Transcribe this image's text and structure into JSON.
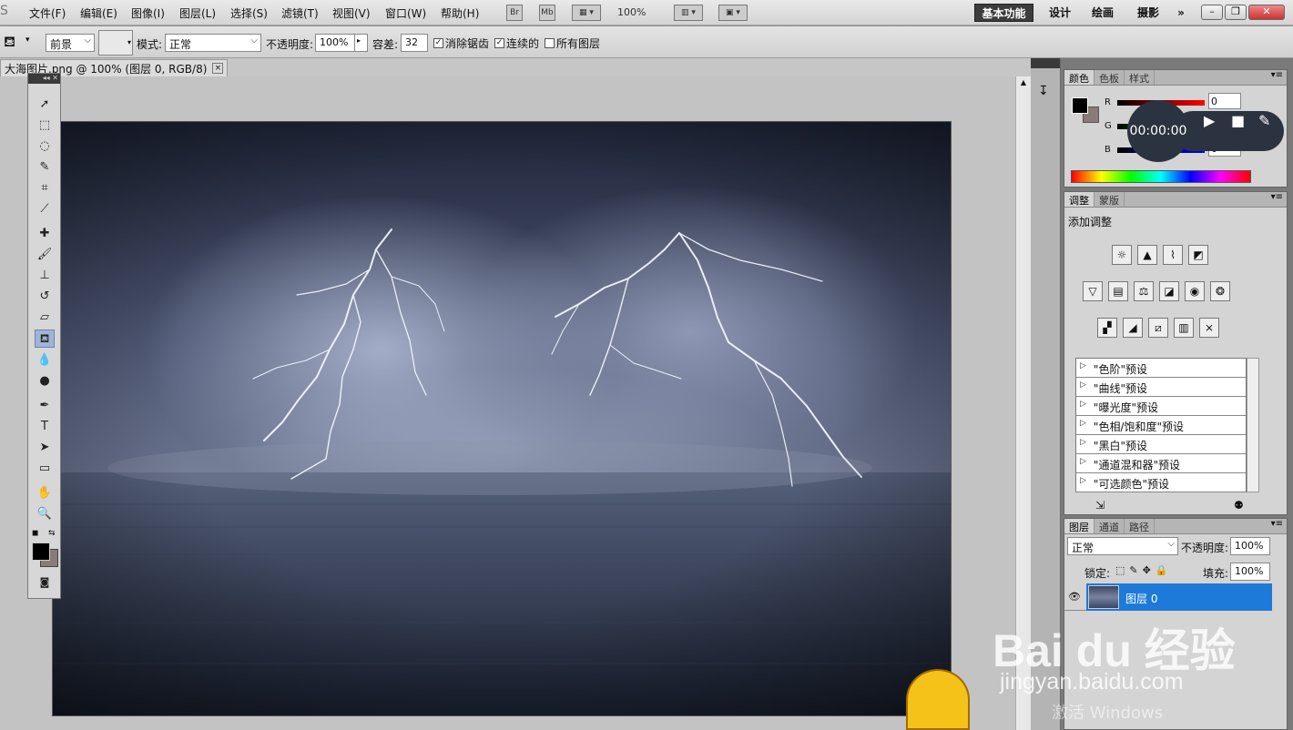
{
  "menubar": {
    "logo": "S",
    "items": [
      "文件(F)",
      "编辑(E)",
      "图像(I)",
      "图层(L)",
      "选择(S)",
      "滤镜(T)",
      "视图(V)",
      "窗口(W)",
      "帮助(H)"
    ],
    "bridge": "Br",
    "minibridge": "Mb",
    "zoom": "100%",
    "workspaces": [
      "基本功能",
      "设计",
      "绘画",
      "摄影"
    ],
    "more": "»"
  },
  "options": {
    "tool_icon": "paint-bucket-icon",
    "source": "前景",
    "mode_label": "模式:",
    "mode_value": "正常",
    "opacity_label": "不透明度:",
    "opacity_value": "100%",
    "tolerance_label": "容差:",
    "tolerance_value": "32",
    "antialias_label": "消除锯齿",
    "antialias_checked": true,
    "contiguous_label": "连续的",
    "contiguous_checked": true,
    "all_layers_label": "所有图层",
    "all_layers_checked": false
  },
  "document": {
    "tab_title": "大海图片.png @ 100% (图层 0, RGB/8)",
    "close": "×"
  },
  "tools": {
    "active": "paint-bucket-tool"
  },
  "color_panel": {
    "tabs": [
      "颜色",
      "色板",
      "样式"
    ],
    "r_label": "R",
    "g_label": "G",
    "b_label": "B",
    "r_value": "0",
    "g_value": "0",
    "b_value": "0",
    "foreground": "#000000",
    "background": "#8a7a7a"
  },
  "adjust_panel": {
    "tabs": [
      "调整",
      "蒙版"
    ],
    "title": "添加调整",
    "presets": [
      "\"色阶\"预设",
      "\"曲线\"预设",
      "\"曝光度\"预设",
      "\"色相/饱和度\"预设",
      "\"黑白\"预设",
      "\"通道混和器\"预设",
      "\"可选颜色\"预设"
    ]
  },
  "layers_panel": {
    "tabs": [
      "图层",
      "通道",
      "路径"
    ],
    "blend_mode": "正常",
    "opacity_label": "不透明度:",
    "opacity_value": "100%",
    "lock_label": "锁定:",
    "fill_label": "填充:",
    "fill_value": "100%",
    "layers": [
      {
        "name": "图层 0",
        "selected": true
      }
    ]
  },
  "recorder": {
    "time": "00:00:00"
  },
  "watermark": {
    "brand": "Bai du 经验",
    "url": "jingyan.baidu.com",
    "activate": "激活 Windows"
  }
}
